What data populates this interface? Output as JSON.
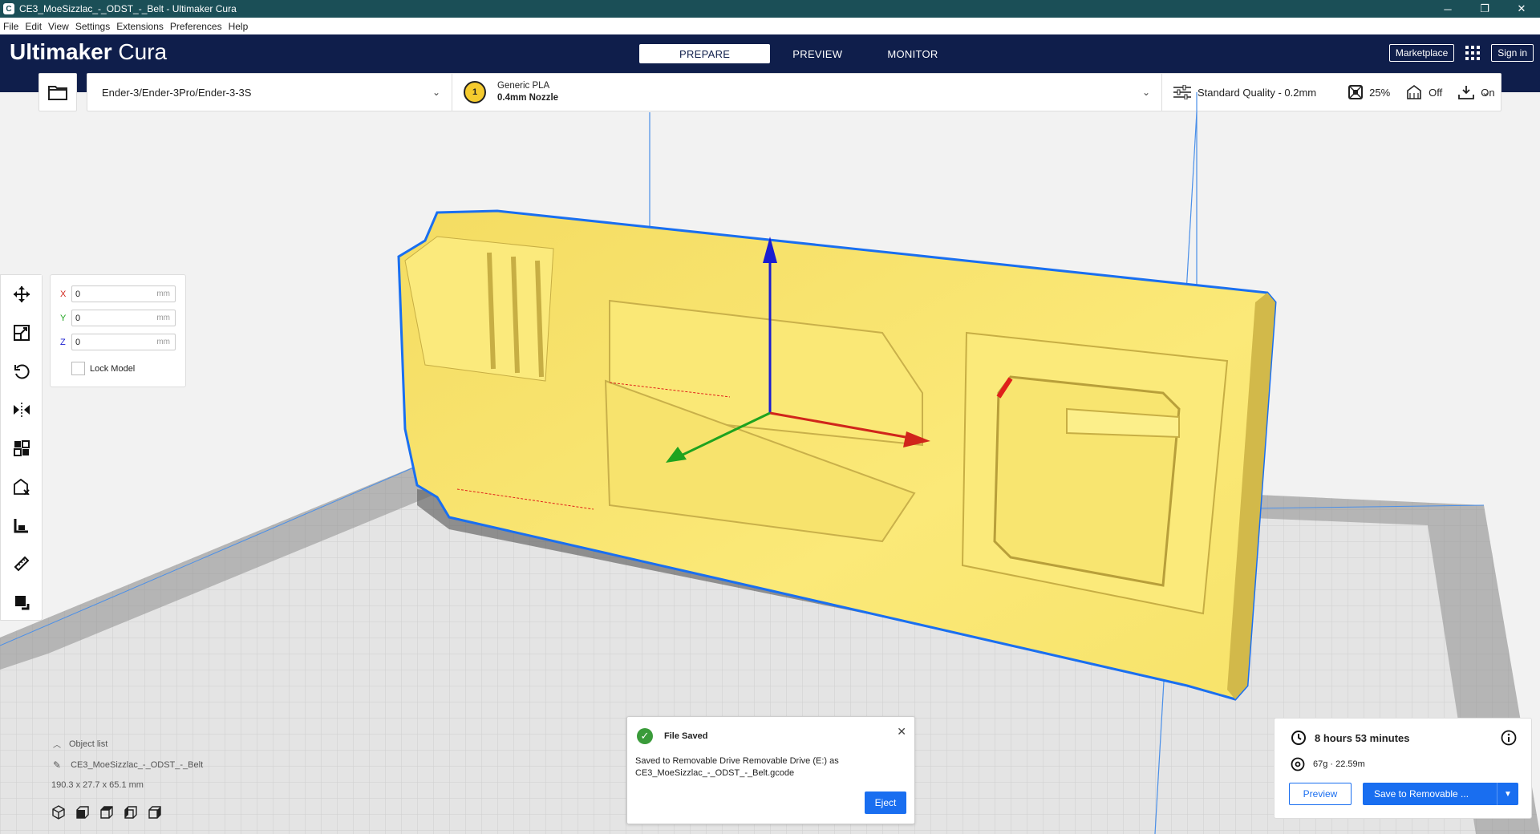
{
  "window": {
    "title": "CE3_MoeSizzlac_-_ODST_-_Belt - Ultimaker Cura",
    "app_icon_letter": "C"
  },
  "menubar": {
    "items": [
      "File",
      "Edit",
      "View",
      "Settings",
      "Extensions",
      "Preferences",
      "Help"
    ]
  },
  "header": {
    "brand_bold": "Ultimaker",
    "brand_light": "Cura",
    "tabs": [
      "PREPARE",
      "PREVIEW",
      "MONITOR"
    ],
    "active_tab": "PREPARE",
    "marketplace": "Marketplace",
    "signin": "Sign in"
  },
  "settings_bar": {
    "printer": "Ender-3/Ender-3Pro/Ender-3-3S",
    "extruder_number": "1",
    "material": "Generic PLA",
    "nozzle": "0.4mm Nozzle",
    "quality": "Standard Quality - 0.2mm",
    "infill": "25%",
    "support": "Off",
    "adhesion": "On"
  },
  "move_panel": {
    "x_label": "X",
    "x_value": "0",
    "y_label": "Y",
    "y_value": "0",
    "z_label": "Z",
    "z_value": "0",
    "unit": "mm",
    "lock_label": "Lock Model",
    "lock_checked": false
  },
  "object_list": {
    "title": "Object list",
    "name": "CE3_MoeSizzlac_-_ODST_-_Belt",
    "dimensions": "190.3 x 27.7 x 65.1 mm"
  },
  "toast": {
    "title": "File Saved",
    "message_line1": "Saved to Removable Drive Removable Drive (E:) as",
    "message_line2": "CE3_MoeSizzlac_-_ODST_-_Belt.gcode",
    "action": "Eject"
  },
  "action_panel": {
    "print_time": "8 hours 53 minutes",
    "material_estimate": "67g · 22.59m",
    "preview_button": "Preview",
    "save_button": "Save to Removable ..."
  },
  "colors": {
    "header_bg": "#0f1e4b",
    "titlebar_bg": "#1b4f57",
    "accent_blue": "#196ef0",
    "model_yellow": "#f9e66a",
    "selection_outline": "#1a6ff0"
  },
  "tools": [
    "move-icon",
    "scale-icon",
    "rotate-icon",
    "mirror-icon",
    "per-model-settings-icon",
    "support-blocker-icon",
    "lay-flat-icon",
    "measure-icon",
    "custom-support-icon"
  ]
}
